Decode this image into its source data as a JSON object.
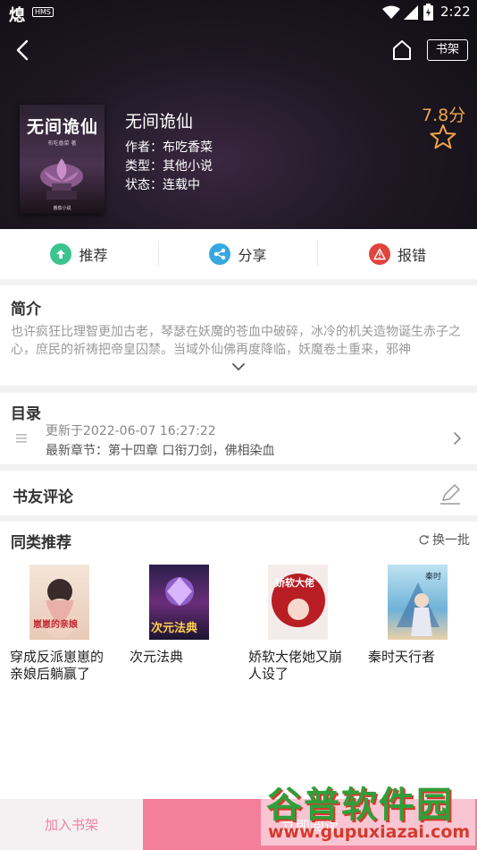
{
  "status_bar": {
    "time": "2:22",
    "left_icon": "fire-icon",
    "app_badge": "HMS"
  },
  "nav": {
    "shelf_label": "书架"
  },
  "book": {
    "title": "无间诡仙",
    "author": "作者：布吃香菜",
    "category": "类型：其他小说",
    "status": "状态：连载中",
    "score": "7.8分",
    "cover_title": "无间诡仙",
    "cover_subtitle": "布吃香菜 著",
    "cover_publisher": "番茄小说"
  },
  "actions": [
    {
      "label": "推荐",
      "icon": "thumb-up-icon",
      "color": "#3cc48f"
    },
    {
      "label": "分享",
      "icon": "share-icon",
      "color": "#36a8e0"
    },
    {
      "label": "报错",
      "icon": "warning-icon",
      "color": "#e0443c"
    }
  ],
  "intro": {
    "title": "简介",
    "text": "也许疯狂比理智更加古老，琴瑟在妖魔的苍血中破碎，冰冷的机关造物诞生赤子之心，庶民的祈祷把帝皇囚禁。当域外仙佛再度降临，妖魔卷土重来，邪神"
  },
  "catalog": {
    "title": "目录",
    "update_time": "更新于2022-06-07 16:27:22",
    "latest": "最新章节：第十四章 口衔刀剑，佛相染血"
  },
  "comments": {
    "title": "书友评论"
  },
  "recommend": {
    "title": "同类推荐",
    "refresh_label": "换一批",
    "books": [
      {
        "name": "穿成反派崽崽的亲娘后躺赢了",
        "cover_text": "崽崽的亲娘"
      },
      {
        "name": "次元法典",
        "cover_text": "次元法典"
      },
      {
        "name": "娇软大佬她又崩人设了",
        "cover_text": "娇软大佬"
      },
      {
        "name": "秦时天行者",
        "cover_text": "秦时"
      }
    ]
  },
  "bottom": {
    "add_shelf": "加入书架",
    "read_now": "立即阅读"
  },
  "watermark": {
    "main": "谷普软件园",
    "url": "www.gupuxiazai.com"
  },
  "colors": {
    "accent": "#f37f9b",
    "score": "#f2a54a",
    "header_bg": "#1a141d"
  }
}
